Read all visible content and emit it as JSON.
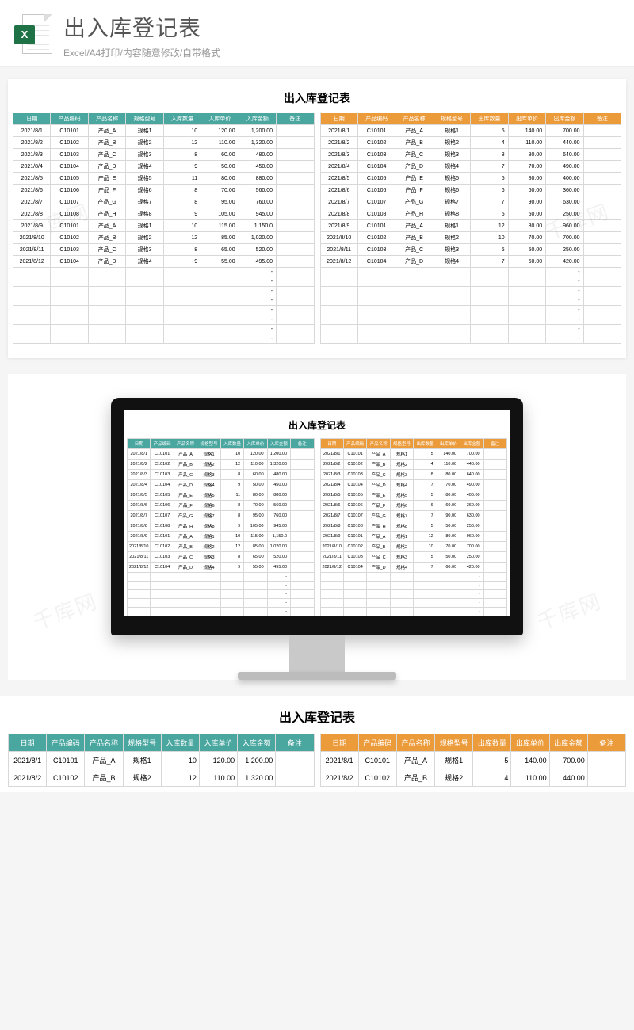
{
  "header": {
    "title": "出入库登记表",
    "subtitle": "Excel/A4打印/内容随意修改/自带格式",
    "icon_label": "X",
    "icon_name": "excel-file-icon"
  },
  "watermark_text": "千库网",
  "sheet": {
    "title": "出入库登记表",
    "in_headers": [
      "日期",
      "产品编码",
      "产品名称",
      "规格型号",
      "入库数量",
      "入库单价",
      "入库金额",
      "备注"
    ],
    "out_headers": [
      "日期",
      "产品编码",
      "产品名称",
      "规格型号",
      "出库数量",
      "出库单价",
      "出库金额",
      "备注"
    ],
    "in_rows": [
      {
        "date": "2021/8/1",
        "code": "C10101",
        "name": "产品_A",
        "spec": "规格1",
        "qty": "10",
        "price": "120.00",
        "amount": "1,200.00",
        "note": ""
      },
      {
        "date": "2021/8/2",
        "code": "C10102",
        "name": "产品_B",
        "spec": "规格2",
        "qty": "12",
        "price": "110.00",
        "amount": "1,320.00",
        "note": ""
      },
      {
        "date": "2021/8/3",
        "code": "C10103",
        "name": "产品_C",
        "spec": "规格3",
        "qty": "8",
        "price": "60.00",
        "amount": "480.00",
        "note": ""
      },
      {
        "date": "2021/8/4",
        "code": "C10104",
        "name": "产品_D",
        "spec": "规格4",
        "qty": "9",
        "price": "50.00",
        "amount": "450.00",
        "note": ""
      },
      {
        "date": "2021/8/5",
        "code": "C10105",
        "name": "产品_E",
        "spec": "规格5",
        "qty": "11",
        "price": "80.00",
        "amount": "880.00",
        "note": ""
      },
      {
        "date": "2021/8/6",
        "code": "C10106",
        "name": "产品_F",
        "spec": "规格6",
        "qty": "8",
        "price": "70.00",
        "amount": "560.00",
        "note": ""
      },
      {
        "date": "2021/8/7",
        "code": "C10107",
        "name": "产品_G",
        "spec": "规格7",
        "qty": "8",
        "price": "95.00",
        "amount": "760.00",
        "note": ""
      },
      {
        "date": "2021/8/8",
        "code": "C10108",
        "name": "产品_H",
        "spec": "规格8",
        "qty": "9",
        "price": "105.00",
        "amount": "945.00",
        "note": ""
      },
      {
        "date": "2021/8/9",
        "code": "C10101",
        "name": "产品_A",
        "spec": "规格1",
        "qty": "10",
        "price": "115.00",
        "amount": "1,150.0",
        "note": ""
      },
      {
        "date": "2021/8/10",
        "code": "C10102",
        "name": "产品_B",
        "spec": "规格2",
        "qty": "12",
        "price": "85.00",
        "amount": "1,020.00",
        "note": ""
      },
      {
        "date": "2021/8/11",
        "code": "C10103",
        "name": "产品_C",
        "spec": "规格3",
        "qty": "8",
        "price": "65.00",
        "amount": "520.00",
        "note": ""
      },
      {
        "date": "2021/8/12",
        "code": "C10104",
        "name": "产品_D",
        "spec": "规格4",
        "qty": "9",
        "price": "55.00",
        "amount": "495.00",
        "note": ""
      }
    ],
    "out_rows": [
      {
        "date": "2021/8/1",
        "code": "C10101",
        "name": "产品_A",
        "spec": "规格1",
        "qty": "5",
        "price": "140.00",
        "amount": "700.00",
        "note": ""
      },
      {
        "date": "2021/8/2",
        "code": "C10102",
        "name": "产品_B",
        "spec": "规格2",
        "qty": "4",
        "price": "110.00",
        "amount": "440.00",
        "note": ""
      },
      {
        "date": "2021/8/3",
        "code": "C10103",
        "name": "产品_C",
        "spec": "规格3",
        "qty": "8",
        "price": "80.00",
        "amount": "640.00",
        "note": ""
      },
      {
        "date": "2021/8/4",
        "code": "C10104",
        "name": "产品_D",
        "spec": "规格4",
        "qty": "7",
        "price": "70.00",
        "amount": "490.00",
        "note": ""
      },
      {
        "date": "2021/8/5",
        "code": "C10105",
        "name": "产品_E",
        "spec": "规格5",
        "qty": "5",
        "price": "80.00",
        "amount": "400.00",
        "note": ""
      },
      {
        "date": "2021/8/6",
        "code": "C10106",
        "name": "产品_F",
        "spec": "规格6",
        "qty": "6",
        "price": "60.00",
        "amount": "360.00",
        "note": ""
      },
      {
        "date": "2021/8/7",
        "code": "C10107",
        "name": "产品_G",
        "spec": "规格7",
        "qty": "7",
        "price": "90.00",
        "amount": "630.00",
        "note": ""
      },
      {
        "date": "2021/8/8",
        "code": "C10108",
        "name": "产品_H",
        "spec": "规格8",
        "qty": "5",
        "price": "50.00",
        "amount": "250.00",
        "note": ""
      },
      {
        "date": "2021/8/9",
        "code": "C10101",
        "name": "产品_A",
        "spec": "规格1",
        "qty": "12",
        "price": "80.00",
        "amount": "960.00",
        "note": ""
      },
      {
        "date": "2021/8/10",
        "code": "C10102",
        "name": "产品_B",
        "spec": "规格2",
        "qty": "10",
        "price": "70.00",
        "amount": "700.00",
        "note": ""
      },
      {
        "date": "2021/8/11",
        "code": "C10103",
        "name": "产品_C",
        "spec": "规格3",
        "qty": "5",
        "price": "50.00",
        "amount": "250.00",
        "note": ""
      },
      {
        "date": "2021/8/12",
        "code": "C10104",
        "name": "产品_D",
        "spec": "规格4",
        "qty": "7",
        "price": "60.00",
        "amount": "420.00",
        "note": ""
      }
    ],
    "empty_dash_rows": 8
  },
  "bottom_strip_rows": 2
}
